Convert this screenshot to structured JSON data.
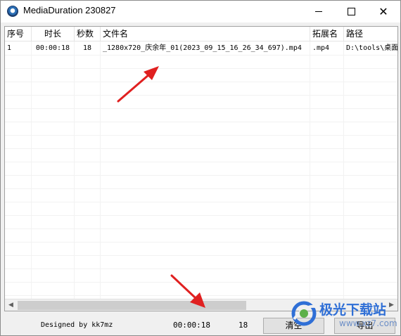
{
  "window": {
    "title": "MediaDuration 230827",
    "minimize_icon": "minimize-icon",
    "maximize_icon": "maximize-icon",
    "close_icon": "close-icon",
    "close_glyph": "✕"
  },
  "table": {
    "columns": [
      "序号",
      "时长",
      "秒数",
      "文件名",
      "拓展名",
      "路径"
    ],
    "rows": [
      {
        "index": "1",
        "duration": "00:00:18",
        "seconds": "18",
        "filename": "_1280x720_庆余年_01(2023_09_15_16_26_34_697).mp4",
        "ext": ".mp4",
        "path": "D:\\tools\\桌面"
      }
    ]
  },
  "scrollbar": {
    "left_glyph": "◀",
    "right_glyph": "▶"
  },
  "status": {
    "designed_by": "Designed by kk7mz",
    "total_duration": "00:00:18",
    "total_seconds": "18"
  },
  "buttons": {
    "clear": "清空",
    "export": "导出"
  },
  "watermark": {
    "name": "极光下载站",
    "url": "www.xz7.com"
  },
  "colors": {
    "annotation_arrow": "#e02020",
    "watermark_blue": "#2f6fd6"
  }
}
